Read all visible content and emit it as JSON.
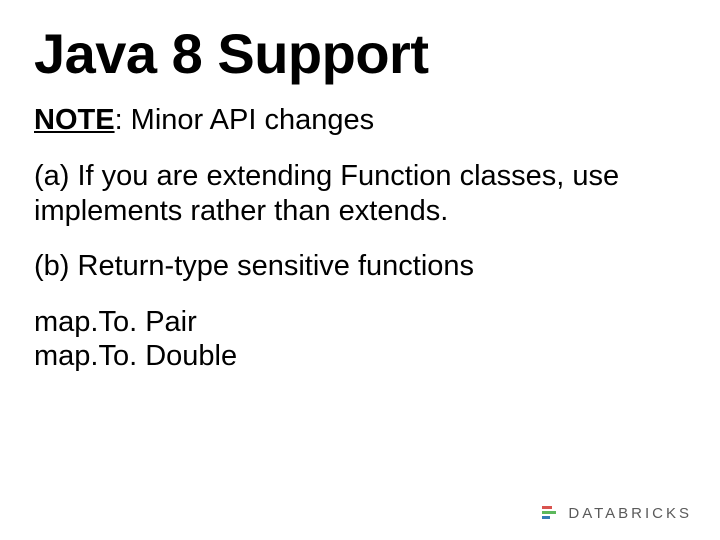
{
  "slide": {
    "title": "Java 8 Support",
    "note_label": "NOTE",
    "note_text": ": Minor API changes",
    "point_a": "(a) If you are extending Function classes, use implements rather than extends.",
    "point_b": "(b) Return-type sensitive functions",
    "code_line_1": "map.To. Pair",
    "code_line_2": "map.To. Double"
  },
  "footer": {
    "brand": "DATABRICKS"
  }
}
